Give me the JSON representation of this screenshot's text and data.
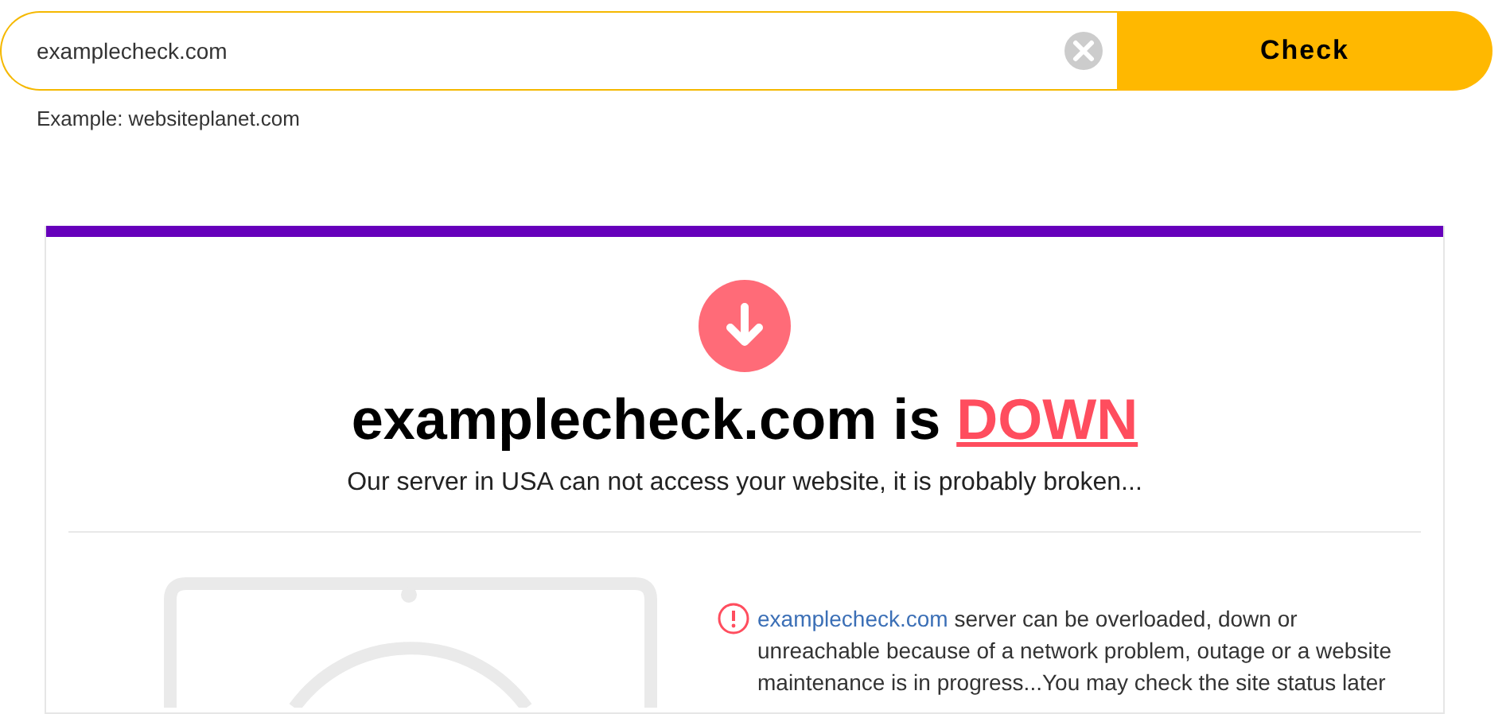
{
  "search": {
    "value": "examplecheck.com",
    "button": "Check",
    "hint": "Example: websiteplanet.com"
  },
  "result": {
    "kind": "down",
    "domain": "examplecheck.com",
    "connector": "is",
    "status_label": "DOWN",
    "subtitle": "Our server in USA can not access your website, it is probably broken...",
    "message": {
      "link": "examplecheck.com",
      "text": "server can be overloaded, down or unreachable because of a network problem, outage or a website maintenance is in progress...You may check the site status later"
    }
  }
}
